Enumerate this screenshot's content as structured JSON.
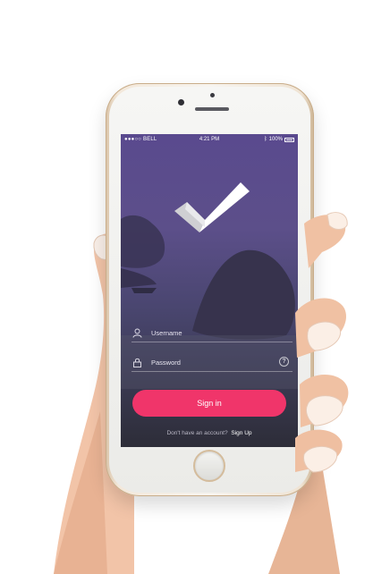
{
  "statusbar": {
    "carrier": "●●●○○ BELL",
    "time": "4:21 PM",
    "battery": "100%"
  },
  "login": {
    "username_placeholder": "Username",
    "password_placeholder": "Password",
    "help_symbol": "?",
    "signin_label": "Sign in",
    "signup_prompt": "Don't have an account?",
    "signup_link": "Sign Up"
  },
  "colors": {
    "accent": "#f0356a",
    "screen_top": "#5a4a8e",
    "screen_bottom": "#2d2d38"
  },
  "icons": {
    "logo": "checkmark-logo",
    "username": "user-icon",
    "password": "lock-icon",
    "help": "help-icon",
    "wifi": "wifi-icon",
    "bluetooth": "bluetooth-icon",
    "battery": "battery-icon"
  }
}
